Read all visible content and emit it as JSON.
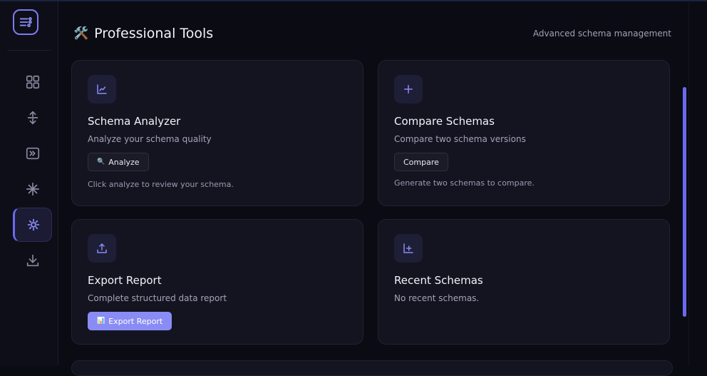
{
  "header": {
    "icon": "🛠️",
    "title": "Professional Tools",
    "subtitle": "Advanced schema management"
  },
  "sidebar": {
    "items": [
      {
        "icon": "grid-icon"
      },
      {
        "icon": "arrows-vertical-icon"
      },
      {
        "icon": "terminal-icon"
      },
      {
        "icon": "sparkle-icon"
      },
      {
        "icon": "gear-icon",
        "active": true
      },
      {
        "icon": "download-icon"
      }
    ]
  },
  "cards": {
    "analyzer": {
      "icon": "chart-icon",
      "title": "Schema Analyzer",
      "desc": "Analyze your schema quality",
      "button_icon": "🔍",
      "button": "Analyze",
      "note": "Click analyze to review your schema."
    },
    "compare": {
      "icon": "plus-icon",
      "title": "Compare Schemas",
      "desc": "Compare two schema versions",
      "button": "Compare",
      "note": "Generate two schemas to compare."
    },
    "export": {
      "icon": "upload-icon",
      "title": "Export Report",
      "desc": "Complete structured data report",
      "button_icon": "📊",
      "button": "Export Report"
    },
    "recent": {
      "icon": "add-chart-icon",
      "title": "Recent Schemas",
      "desc": "No recent schemas."
    }
  },
  "colors": {
    "accent": "#6a6af0",
    "primary_button": "#8a8cf5",
    "card_bg": "#141421",
    "page_bg": "#0b0b14"
  }
}
